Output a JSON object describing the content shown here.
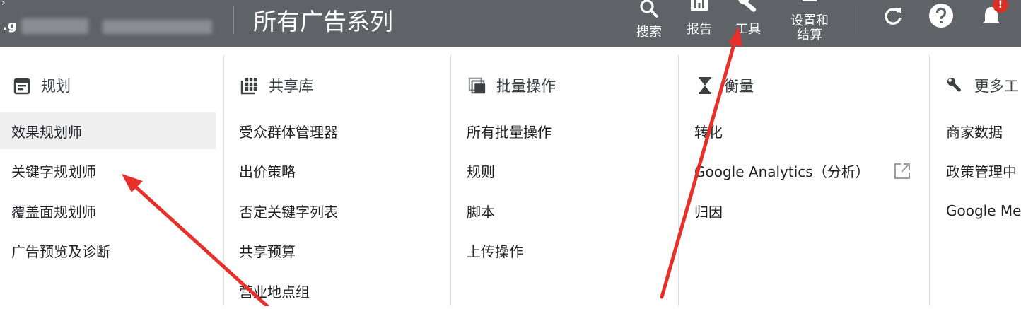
{
  "header": {
    "account_prefix": ".g",
    "page_title": "所有广告系列",
    "tools": [
      {
        "label": "搜索",
        "icon": "search-icon"
      },
      {
        "label": "报告",
        "icon": "reports-icon"
      },
      {
        "label": "工具",
        "icon": "wrench-icon"
      },
      {
        "label_line1": "设置和",
        "label_line2": "结算",
        "icon": "settings-icon"
      }
    ],
    "notification_count": "!"
  },
  "menu": {
    "columns": [
      {
        "heading": "规划",
        "icon": "calendar-icon",
        "items": [
          "效果规划师",
          "关键字规划师",
          "覆盖面规划师",
          "广告预览及诊断"
        ]
      },
      {
        "heading": "共享库",
        "icon": "grid-library-icon",
        "items": [
          "受众群体管理器",
          "出价策略",
          "否定关键字列表",
          "共享预算",
          "营业地点组"
        ]
      },
      {
        "heading": "批量操作",
        "icon": "stacked-copy-icon",
        "items": [
          "所有批量操作",
          "规则",
          "脚本",
          "上传操作"
        ]
      },
      {
        "heading": "衡量",
        "icon": "hourglass-icon",
        "items": [
          "转化",
          "Google Analytics（分析）",
          "归因"
        ]
      },
      {
        "heading": "更多工",
        "icon": "wrench-icon",
        "items": [
          "商家数据",
          "政策管理中",
          "Google Me"
        ]
      }
    ],
    "selected_item": "效果规划师"
  },
  "colors": {
    "topbar": "#5f6368",
    "annotation_arrow": "#e8302a",
    "selected_bg": "#eeeeee"
  }
}
